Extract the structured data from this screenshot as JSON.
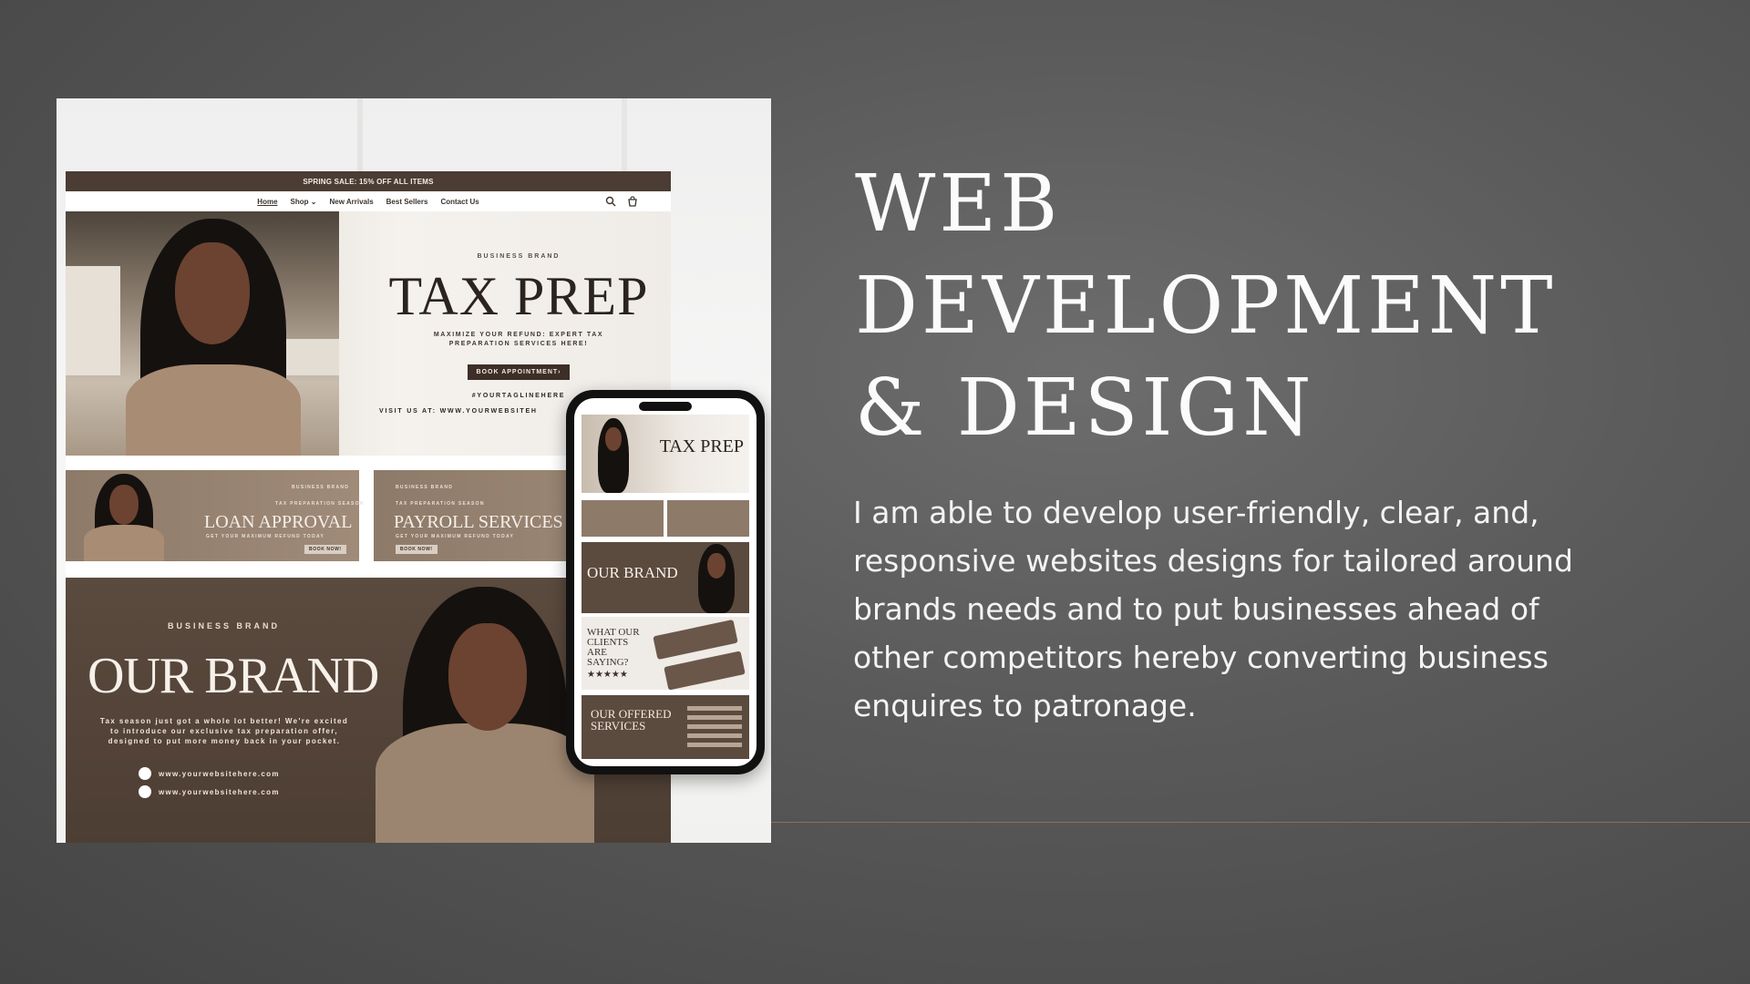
{
  "headline": {
    "line1": "WEB",
    "line2": "DEVELOPMENT",
    "line3": "& DESIGN"
  },
  "description": "I am able to develop user-friendly, clear, and, responsive websites designs for tailored around brands needs and to put businesses ahead of other competitors hereby converting business enquires to patronage.",
  "mockup": {
    "announcement": "SPRING SALE: 15% OFF ALL ITEMS",
    "nav": {
      "home": "Home",
      "shop": "Shop",
      "new_arrivals": "New Arrivals",
      "best_sellers": "Best Sellers",
      "contact": "Contact Us"
    },
    "hero": {
      "eyebrow": "BUSINESS BRAND",
      "title": "TAX PREP",
      "subtitle_1": "MAXIMIZE YOUR REFUND: EXPERT TAX",
      "subtitle_2": "PREPARATION SERVICES HERE!",
      "button": "BOOK APPOINTMENT›",
      "tagline": "#YOURTAGLINEHERE",
      "visit": "VISIT US AT: WWW.YOURWEBSITEH"
    },
    "cards": [
      {
        "eyebrow": "BUSINESS BRAND",
        "small": "TAX PREPARATION SEASON",
        "title": "LOAN APPROVAL",
        "sub": "GET YOUR MAXIMUM REFUND TODAY",
        "button": "BOOK NOW!"
      },
      {
        "eyebrow": "BUSINESS BRAND",
        "small": "TAX PREPARATION SEASON",
        "title": "PAYROLL SERVICES",
        "sub": "GET YOUR MAXIMUM REFUND TODAY",
        "button": "BOOK NOW!"
      }
    ],
    "brand": {
      "eyebrow": "BUSINESS BRAND",
      "title": "OUR BRAND",
      "para": "Tax season just got a whole lot better! We're excited to introduce our exclusive tax preparation offer, designed to put more money back in your pocket.",
      "link_1": "www.yourwebsitehere.com",
      "link_2": "www.yourwebsitehere.com"
    },
    "phone": {
      "hero_title": "TAX PREP",
      "brand_title": "OUR BRAND",
      "testimonials_title": "WHAT OUR CLIENTS ARE SAYING?",
      "stars": "★★★★★",
      "services_title": "OUR OFFERED SERVICES"
    }
  },
  "colors": {
    "background": "#5a5a5a",
    "accent_line": "#8c6f63",
    "brand_dark": "#4b3d33"
  }
}
